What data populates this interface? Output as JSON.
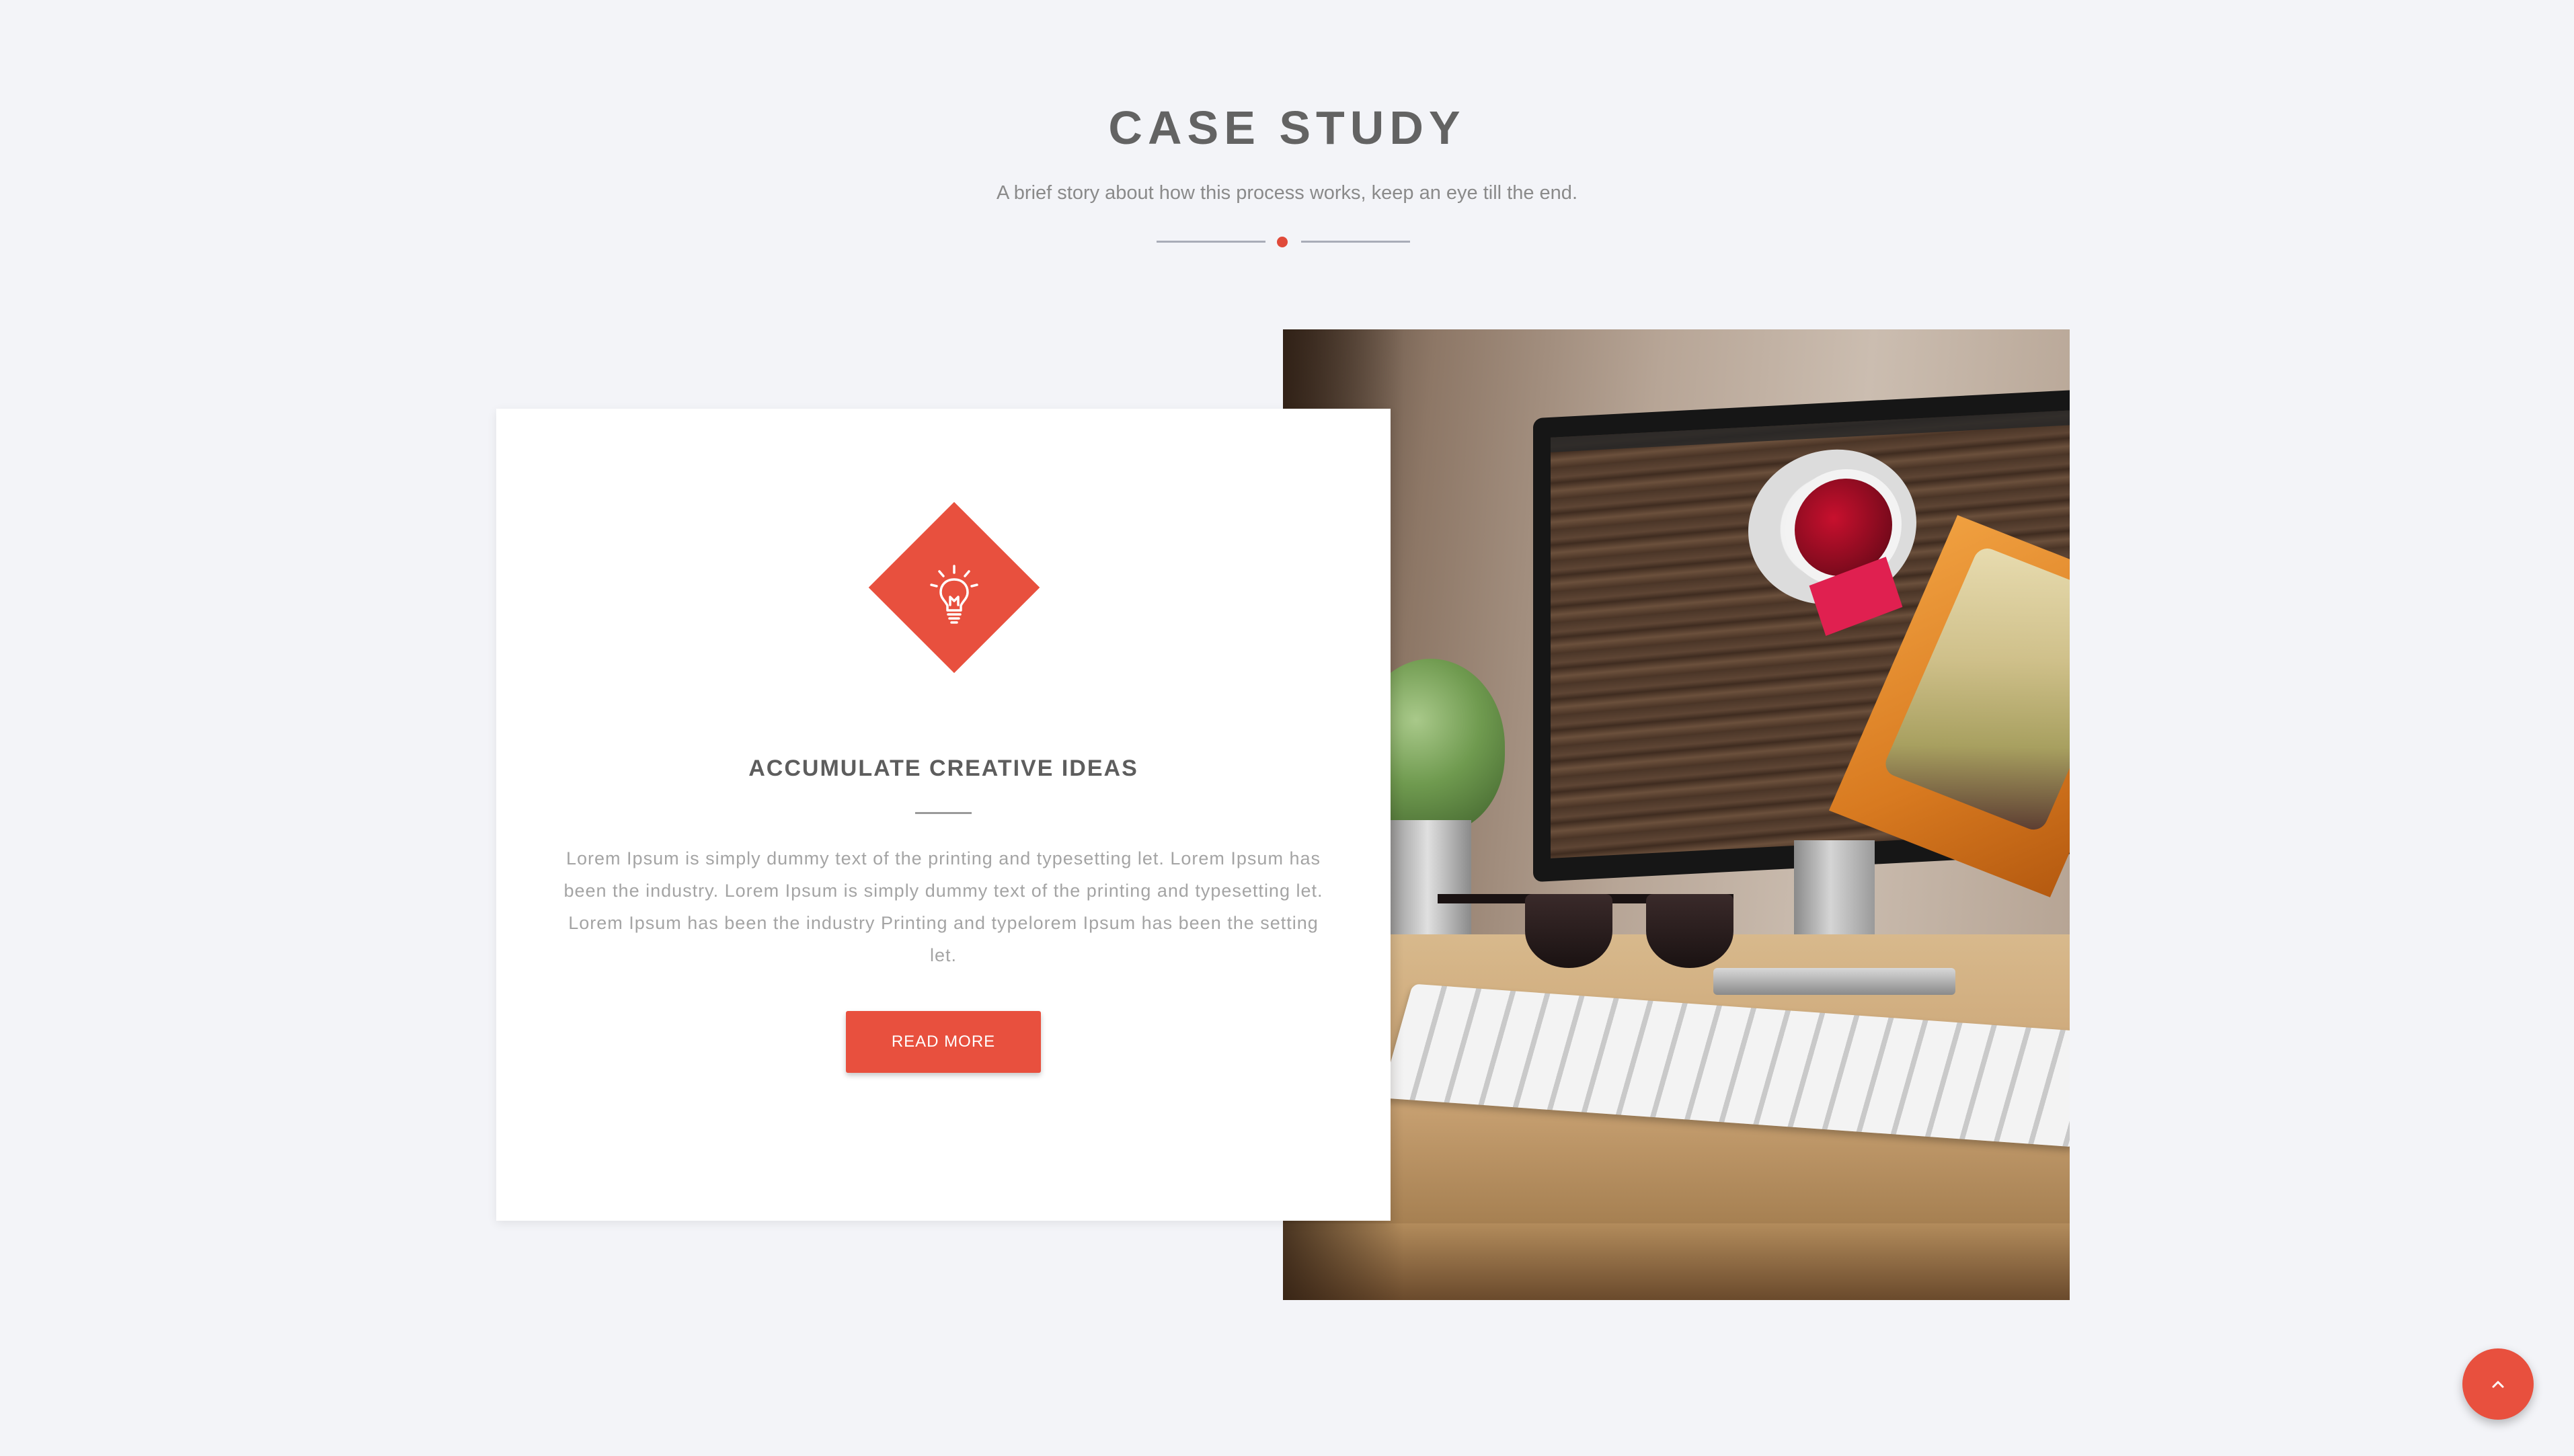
{
  "section": {
    "title": "CASE STUDY",
    "subtitle": "A brief story about how this process works, keep an eye till the end."
  },
  "card": {
    "icon": "lightbulb-icon",
    "title": "ACCUMULATE CREATIVE IDEAS",
    "text": "Lorem Ipsum is simply dummy text of the printing and typesetting let. Lorem Ipsum has been the industry. Lorem Ipsum is simply dummy text of the printing and typesetting let. Lorem Ipsum has been the industry Printing and typelorem Ipsum has been the setting let.",
    "button_label": "READ MORE"
  },
  "photo": {
    "subject": "desk-workspace-photo"
  },
  "back_to_top": {
    "icon": "chevron-up-icon"
  },
  "colors": {
    "accent": "#e8503e",
    "background": "#f3f4f8",
    "title": "#636363",
    "muted_text": "#a4a4a4"
  }
}
